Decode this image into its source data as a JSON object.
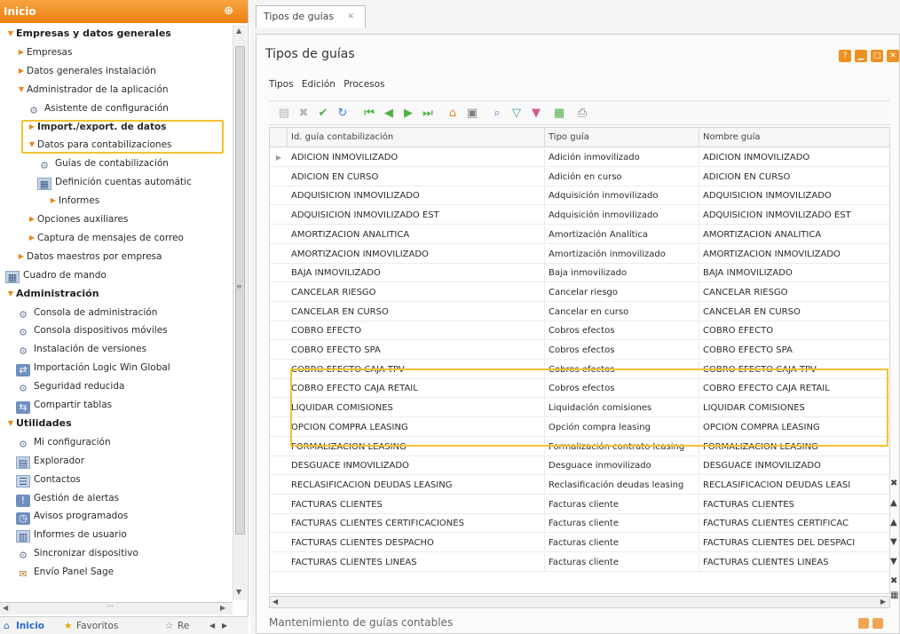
{
  "left_panel": {
    "title": "Inicio",
    "tree": [
      {
        "label": "Empresas y datos generales",
        "level": 0,
        "group": true,
        "expanded": true
      },
      {
        "label": "Empresas",
        "level": 1
      },
      {
        "label": "Datos generales instalación",
        "level": 1
      },
      {
        "label": "Administrador de la aplicación",
        "level": 1,
        "expanded": true
      },
      {
        "label": "Asistente de configuración",
        "level": 2,
        "icon": "gear-icon"
      },
      {
        "label": "Import./export. de datos",
        "level": 2,
        "bold": true
      },
      {
        "label": "Datos para contabilizaciones",
        "level": 2,
        "expanded": true
      },
      {
        "label": "Guías de contabilización",
        "level": 3,
        "icon": "gear-icon"
      },
      {
        "label": "Definición cuentas automátic",
        "level": 3,
        "icon": "grid-icon"
      },
      {
        "label": "Informes",
        "level": 4
      },
      {
        "label": "Opciones auxiliares",
        "level": 2
      },
      {
        "label": "Captura de mensajes de correo",
        "level": 2
      },
      {
        "label": "Datos maestros por empresa",
        "level": 1
      },
      {
        "label": "Cuadro de mando",
        "level": 0,
        "icon": "dashboard-icon"
      },
      {
        "label": "Administración",
        "level": 0,
        "group": true,
        "expanded": true
      },
      {
        "label": "Consola de administración",
        "level": 1,
        "icon": "gear-icon"
      },
      {
        "label": "Consola dispositivos móviles",
        "level": 1,
        "icon": "gear-icon"
      },
      {
        "label": "Instalación de versiones",
        "level": 1,
        "icon": "gear-icon"
      },
      {
        "label": "Importación Logic Win Global",
        "level": 1,
        "icon": "import-icon"
      },
      {
        "label": "Seguridad reducida",
        "level": 1,
        "icon": "gear-icon"
      },
      {
        "label": "Compartir tablas",
        "level": 1,
        "icon": "share-icon"
      },
      {
        "label": "Utilidades",
        "level": 0,
        "group": true,
        "expanded": true
      },
      {
        "label": "Mi configuración",
        "level": 1,
        "icon": "gear-icon"
      },
      {
        "label": "Explorador",
        "level": 1,
        "icon": "folder-icon"
      },
      {
        "label": "Contactos",
        "level": 1,
        "icon": "contacts-icon"
      },
      {
        "label": "Gestión de alertas",
        "level": 1,
        "icon": "alert-icon"
      },
      {
        "label": "Avisos programados",
        "level": 1,
        "icon": "clock-icon"
      },
      {
        "label": "Informes de usuario",
        "level": 1,
        "icon": "report-icon"
      },
      {
        "label": "Sincronizar dispositivo",
        "level": 1,
        "icon": "gear-icon"
      },
      {
        "label": "Envío Panel Sage",
        "level": 1,
        "icon": "send-icon"
      }
    ],
    "bottom_tabs": [
      "Inicio",
      "Favoritos",
      "Re"
    ]
  },
  "main": {
    "tab_label": "Tipos de guías",
    "form_title": "Tipos de guías",
    "menu": [
      "Tipos",
      "Edición",
      "Procesos"
    ],
    "grid": {
      "columns": [
        "Id. guía contabilización",
        "Tipo guía",
        "Nombre guía"
      ],
      "rows": [
        [
          "ADICION INMOVILIZADO",
          "Adición inmovilizado",
          "ADICION INMOVILIZADO"
        ],
        [
          "ADICION EN CURSO",
          "Adición en curso",
          "ADICION EN CURSO"
        ],
        [
          "ADQUISICION INMOVILIZADO",
          "Adquisición inmovilizado",
          "ADQUISICION INMOVILIZADO"
        ],
        [
          "ADQUISICION INMOVILIZADO EST",
          "Adquisición inmovilizado",
          "ADQUISICION INMOVILIZADO EST"
        ],
        [
          "AMORTIZACION ANALITICA",
          "Amortización Analítica",
          "AMORTIZACION ANALITICA"
        ],
        [
          "AMORTIZACION INMOVILIZADO",
          "Amortización inmovilizado",
          "AMORTIZACION INMOVILIZADO"
        ],
        [
          "BAJA INMOVILIZADO",
          "Baja inmovilizado",
          "BAJA INMOVILIZADO"
        ],
        [
          "CANCELAR RIESGO",
          "Cancelar riesgo",
          "CANCELAR RIESGO"
        ],
        [
          "CANCELAR EN CURSO",
          "Cancelar en curso",
          "CANCELAR EN CURSO"
        ],
        [
          "COBRO EFECTO",
          "Cobros efectos",
          "COBRO EFECTO"
        ],
        [
          "COBRO EFECTO SPA",
          "Cobros efectos",
          "COBRO EFECTO SPA"
        ],
        [
          "COBRO EFECTO CAJA TPV",
          "Cobros efectos",
          "COBRO EFECTO CAJA TPV"
        ],
        [
          "COBRO EFECTO CAJA RETAIL",
          "Cobros efectos",
          "COBRO EFECTO CAJA RETAIL"
        ],
        [
          "LIQUIDAR COMISIONES",
          "Liquidación comisiones",
          "LIQUIDAR COMISIONES"
        ],
        [
          "OPCION COMPRA LEASING",
          "Opción compra leasing",
          "OPCION COMPRA LEASING"
        ],
        [
          "FORMALIZACION LEASING",
          "Formalización contrato leasing",
          "FORMALIZACION LEASING"
        ],
        [
          "DESGUACE INMOVILIZADO",
          "Desguace inmovilizado",
          "DESGUACE INMOVILIZADO"
        ],
        [
          "RECLASIFICACION DEUDAS LEASING",
          "Reclasificación deudas leasing",
          "RECLASIFICACION DEUDAS LEASI"
        ],
        [
          "FACTURAS CLIENTES",
          "Facturas cliente",
          "FACTURAS CLIENTES"
        ],
        [
          "FACTURAS CLIENTES CERTIFICACIONES",
          "Facturas cliente",
          "FACTURAS CLIENTES CERTIFICAC"
        ],
        [
          "FACTURAS CLIENTES DESPACHO",
          "Facturas cliente",
          "FACTURAS CLIENTES DEL DESPACI"
        ],
        [
          "FACTURAS CLIENTES LINEAS",
          "Facturas cliente",
          "FACTURAS CLIENTES LINEAS"
        ]
      ]
    },
    "status": "Mantenimiento de guías contables"
  },
  "colors": {
    "accent": "#ec7f10",
    "highlight": "#f2c233"
  }
}
